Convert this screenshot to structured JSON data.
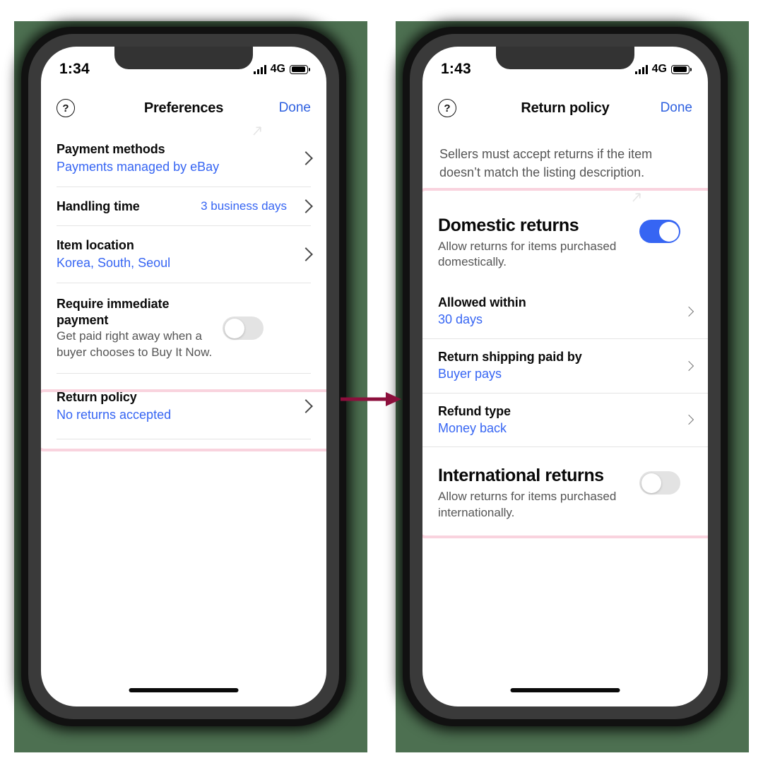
{
  "meta": {
    "accent_blue": "#3665f3",
    "link_blue": "#2f61e0",
    "highlight_pink": "#f9d3de",
    "arrow_color": "#8c0f3c",
    "backdrop_green": "#4d7051",
    "toggle_on_color": "#3665f3",
    "toggle_off_color": "#e3e3e3"
  },
  "phone_left": {
    "status": {
      "time": "1:34",
      "network": "4G",
      "signal_icon": "signal-bars-icon",
      "battery_icon": "battery-full-icon"
    },
    "nav": {
      "help_icon": "help-circle-icon",
      "help_glyph": "?",
      "title": "Preferences",
      "done_label": "Done"
    },
    "rows": [
      {
        "title": "Payment methods",
        "value": "Payments managed by eBay",
        "chevron_icon": "chevron-right-icon"
      },
      {
        "title": "Handling time",
        "value_right": "3 business days",
        "chevron_icon": "chevron-right-icon"
      },
      {
        "title": "Item location",
        "value": "Korea, South, Seoul",
        "chevron_icon": "chevron-right-icon"
      },
      {
        "title": "Require immediate payment",
        "sub": "Get paid right away when a buyer chooses to Buy It Now.",
        "toggle": "off"
      },
      {
        "title": "Return policy",
        "value": "No returns accepted",
        "chevron_icon": "chevron-right-icon",
        "highlighted": true
      }
    ]
  },
  "phone_right": {
    "status": {
      "time": "1:43",
      "network": "4G",
      "signal_icon": "signal-bars-icon",
      "battery_icon": "battery-full-icon"
    },
    "nav": {
      "help_icon": "help-circle-icon",
      "help_glyph": "?",
      "title": "Return policy",
      "done_label": "Done"
    },
    "intro": "Sellers must accept returns if the item doesn’t match the listing description.",
    "domestic": {
      "title": "Domestic returns",
      "desc": "Allow returns for items purchased domestically.",
      "toggle": "on"
    },
    "domestic_rows": [
      {
        "title": "Allowed within",
        "value": "30 days",
        "chevron_icon": "chevron-right-icon"
      },
      {
        "title": "Return shipping paid by",
        "value": "Buyer pays",
        "chevron_icon": "chevron-right-icon"
      },
      {
        "title": "Refund type",
        "value": "Money back",
        "chevron_icon": "chevron-right-icon"
      }
    ],
    "international": {
      "title": "International returns",
      "desc": "Allow returns for items purchased internationally.",
      "toggle": "off"
    }
  },
  "annotation": {
    "arrow_icon": "flow-arrow-right-icon"
  }
}
